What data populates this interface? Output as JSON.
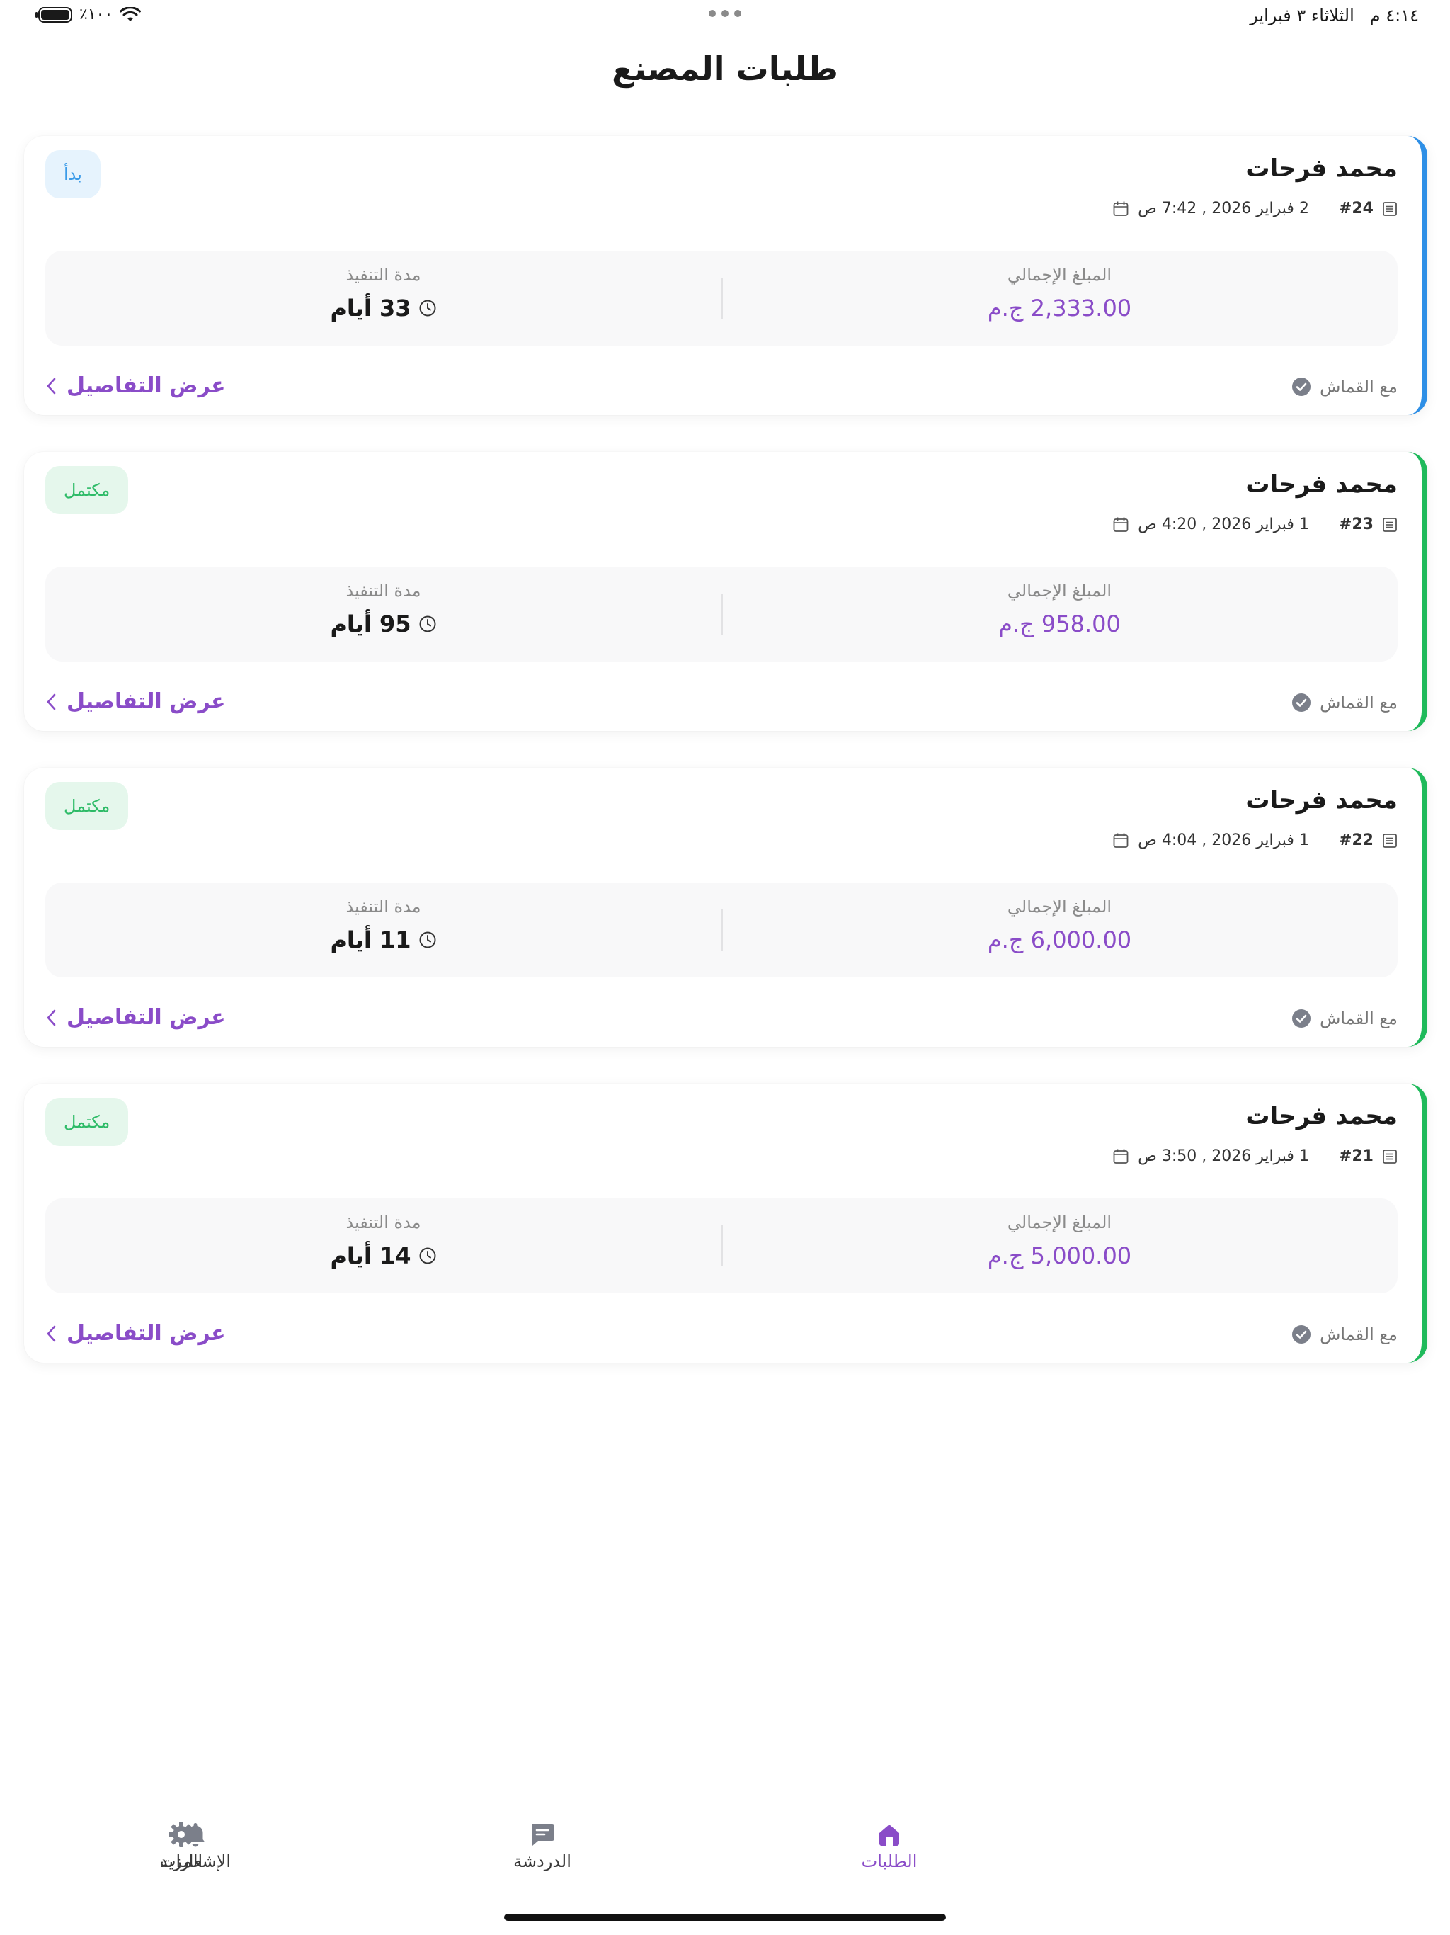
{
  "status_bar": {
    "battery": "٪١٠٠",
    "time": "٤:١٤ م",
    "date": "الثلاثاء ٣ فبراير"
  },
  "page": {
    "title": "طلبات المصنع"
  },
  "labels": {
    "total_amount": "المبلغ الإجمالي",
    "duration": "مدة التنفيذ",
    "with_fabric": "مع القماش",
    "view_details": "عرض التفاصيل"
  },
  "orders": [
    {
      "customer": "محمد فرحات",
      "id": "#24",
      "date": "2 فبراير 2026 , 7:42 ص",
      "status": "بدأ",
      "amount": "2,333.00 ج.م",
      "duration": "33 أيام"
    },
    {
      "customer": "محمد فرحات",
      "id": "#23",
      "date": "1 فبراير 2026 , 4:20 ص",
      "status": "مكتمل",
      "amount": "958.00 ج.م",
      "duration": "95 أيام"
    },
    {
      "customer": "محمد فرحات",
      "id": "#22",
      "date": "1 فبراير 2026 , 4:04 ص",
      "status": "مكتمل",
      "amount": "6,000.00 ج.م",
      "duration": "11 أيام"
    },
    {
      "customer": "محمد فرحات",
      "id": "#21",
      "date": "1 فبراير 2026 , 3:50 ص",
      "status": "مكتمل",
      "amount": "5,000.00 ج.م",
      "duration": "14 أيام"
    }
  ],
  "nav": {
    "orders": "الطلبات",
    "chat": "الدردشة",
    "notifications": "الإشعارات",
    "more": "المزيد"
  },
  "colors": {
    "accent": "#8a4cc8",
    "started": "#2e8fe6",
    "completed": "#1fba5b"
  }
}
